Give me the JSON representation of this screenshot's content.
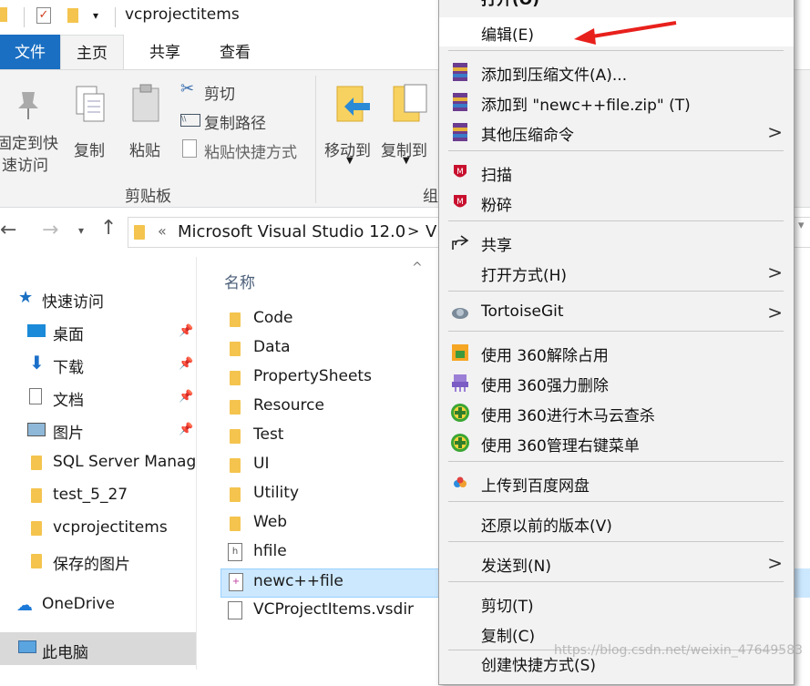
{
  "window": {
    "title": "vcprojectitems"
  },
  "ribbon_tabs": [
    "文件",
    "主页",
    "共享",
    "查看"
  ],
  "ribbon": {
    "pin_label_1": "固定到快",
    "pin_label_2": "速访问",
    "copy": "复制",
    "paste": "粘贴",
    "cut": "剪切",
    "copy_path": "复制路径",
    "paste_shortcut": "粘贴快捷方式",
    "clipboard_group": "剪贴板",
    "move_to": "移动到",
    "copy_to": "复制到",
    "organize_partial": "组"
  },
  "address": {
    "breadcrumb_sep": "«",
    "path1": "Microsoft Visual Studio 12.0",
    "chev": ">",
    "path2_partial": "V"
  },
  "nav_pane": {
    "quick_access": "快速访问",
    "items": [
      "桌面",
      "下载",
      "文档",
      "图片",
      "SQL Server Manag",
      "test_5_27",
      "vcprojectitems",
      "保存的图片"
    ],
    "onedrive": "OneDrive",
    "this_pc": "此电脑"
  },
  "file_list": {
    "name_header": "名称",
    "items": [
      "Code",
      "Data",
      "PropertySheets",
      "Resource",
      "Test",
      "UI",
      "Utility",
      "Web",
      "hfile",
      "newc++file",
      "VCProjectItems.vsdir"
    ]
  },
  "context_menu": {
    "open_partial": "打开(O)",
    "edit": "编辑(E)",
    "add_to_archive": "添加到压缩文件(A)...",
    "add_to_zip": "添加到 \"newc++file.zip\" (T)",
    "other_compress": "其他压缩命令",
    "scan": "扫描",
    "shred": "粉碎",
    "share": "共享",
    "open_with": "打开方式(H)",
    "tortoisegit": "TortoiseGit",
    "unlock_360": "使用 360解除占用",
    "force_delete_360": "使用 360强力删除",
    "trojan_scan_360": "使用 360进行木马云查杀",
    "manage_menu_360": "使用 360管理右键菜单",
    "upload_baidu": "上传到百度网盘",
    "restore_versions": "还原以前的版本(V)",
    "send_to": "发送到(N)",
    "cut": "剪切(T)",
    "copy": "复制(C)",
    "create_shortcut_partial": "创建快捷方式(S)"
  },
  "watermark": "https://blog.csdn.net/weixin_47649583",
  "colors": {
    "accent": "#1a6fc2",
    "selection": "#cce8ff",
    "arrow": "#e8201c"
  }
}
